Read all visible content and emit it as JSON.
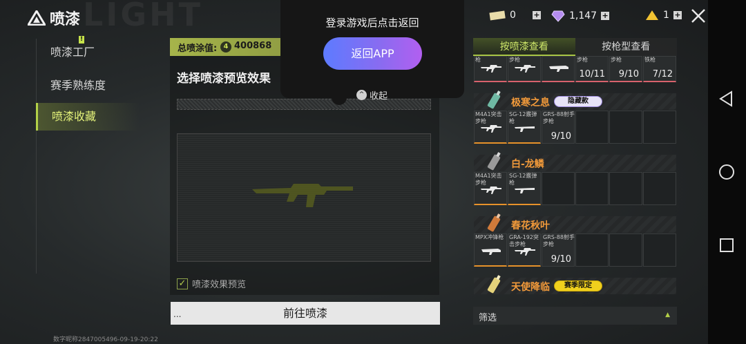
{
  "header": {
    "app_title": "喷漆",
    "bg_word": "LIGHT"
  },
  "menu": {
    "items": [
      {
        "label": "喷漆工厂"
      },
      {
        "label": "赛季熟练度",
        "badge": "!"
      },
      {
        "label": "喷漆收藏"
      }
    ]
  },
  "center": {
    "total_label": "总喷涂值:",
    "total_value": "400868",
    "coin_icon_text": "4",
    "warn_text": "!",
    "section_title": "选择喷漆预览效果",
    "preview_label": "喷漆效果预览",
    "go_button": "前往喷漆",
    "go_button_dots": "...",
    "footer_id": "数字昵称2847005496-09-19-20:22"
  },
  "popup": {
    "message": "登录游戏后点击返回",
    "return_button": "返回APP",
    "collapse_label": "收起",
    "collapse_icon_text": "^"
  },
  "currencies": [
    {
      "icon": "ticket-icon",
      "value": "0"
    },
    {
      "icon": "diamond-icon",
      "value": "1,147"
    },
    {
      "icon": "pyramid-icon",
      "value": "1"
    }
  ],
  "plus_label": "+",
  "right": {
    "tabs": [
      {
        "label": "按喷漆查看",
        "active": true
      },
      {
        "label": "按枪型查看",
        "active": false
      }
    ],
    "top_row": [
      {
        "name": "枪",
        "count": ""
      },
      {
        "name": "步枪",
        "count": ""
      },
      {
        "name": "",
        "count": ""
      },
      {
        "name": "步枪",
        "count": "10/11"
      },
      {
        "name": "步枪",
        "count": "9/10"
      },
      {
        "name": "铁枪",
        "count": "7/12"
      }
    ],
    "groups": [
      {
        "name": "极寒之息",
        "pill": "隐藏款",
        "cells": [
          {
            "name": "M4A1突击步枪",
            "count": ""
          },
          {
            "name": "SG-12霰弹枪",
            "count": ""
          },
          {
            "name": "GRS-88射手步枪",
            "count": "9/10"
          }
        ]
      },
      {
        "name": "白-龙鳞",
        "pill": "",
        "cells": [
          {
            "name": "M4A1突击步枪",
            "count": ""
          },
          {
            "name": "SG-12霰弹枪",
            "count": ""
          }
        ]
      },
      {
        "name": "春花秋叶",
        "pill": "",
        "cells": [
          {
            "name": "MPX冲锋枪",
            "count": ""
          },
          {
            "name": "GRA-192突击步枪",
            "count": ""
          },
          {
            "name": "GRS-88射手步枪",
            "count": "9/10"
          }
        ]
      },
      {
        "name": "天使降临",
        "pill": "赛季限定",
        "cells": []
      }
    ],
    "filter_label": "筛选",
    "filter_arrow": "▲"
  },
  "colors": {
    "accent": "#b4d248",
    "orange": "#f29a3a",
    "popup_gradient_start": "#5d7bff",
    "popup_gradient_end": "#b25ff0"
  }
}
